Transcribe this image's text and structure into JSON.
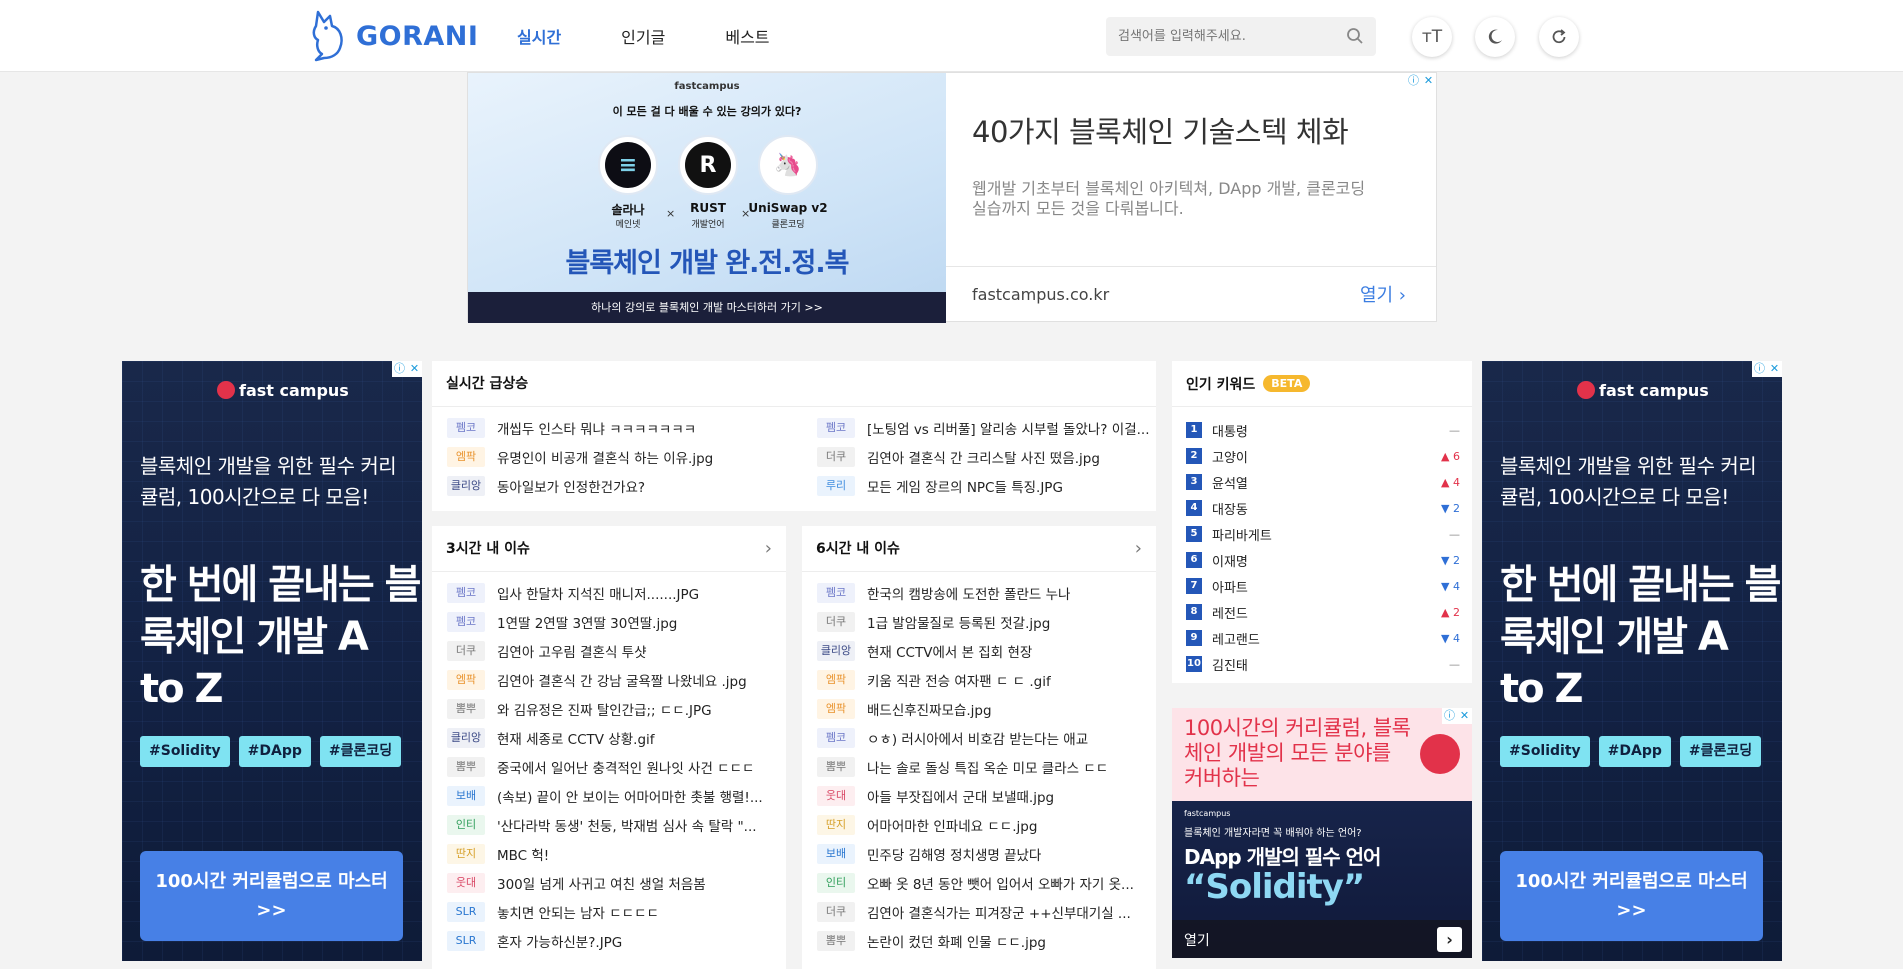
{
  "header": {
    "logo": "GORANI",
    "nav": [
      "실시간",
      "인기글",
      "베스트"
    ],
    "search_placeholder": "검색어를 입력해주세요.",
    "buttons": [
      "font-size-icon",
      "dark-mode-icon",
      "refresh-icon"
    ]
  },
  "top_ad": {
    "brand": "fastcampus",
    "question": "이 모든 걸 다 배울 수 있는 강의가 있다?",
    "coins": [
      {
        "name": "솔라나",
        "sub": "메인넷"
      },
      {
        "name": "RUST",
        "sub": "개발언어"
      },
      {
        "name": "UniSwap v2",
        "sub": "클론코딩"
      }
    ],
    "headline": "블록체인 개발 완.전.정.복",
    "bar": "하나의 강의로 블록체인 개발 마스터하러 가기 >>",
    "title": "40가지 블록체인 기술스텍 체화",
    "desc": "웹개발 기초부터 블록체인 아키텍쳐, DApp 개발, 클론코딩 실습까지 모든 것을 다뤄봅니다.",
    "url": "fastcampus.co.kr",
    "open": "열기"
  },
  "side_ad": {
    "brand": "fast campus",
    "line1": "블록체인 개발을 위한 필수 커리큘럼, 100시간으로 다 모음!",
    "line2": "한 번에 끝내는 블록체인 개발 A to Z",
    "tags": [
      "#Solidity",
      "#DApp",
      "#클론코딩"
    ],
    "cta": "100시간 커리큘럼으로 마스터 >>"
  },
  "realtime": {
    "title": "실시간 급상승",
    "left": [
      {
        "badge": "펨코",
        "title": "개씹두 인스타 뭐냐 ㅋㅋㅋㅋㅋㅋㅋ"
      },
      {
        "badge": "엠팍",
        "title": "유명인이 비공개 결혼식 하는 이유.jpg"
      },
      {
        "badge": "클리앙",
        "title": "동아일보가 인정한건가요?"
      }
    ],
    "right": [
      {
        "badge": "펨코",
        "title": "[노팅엄 vs 리버풀] 알리송 시부럴 돌았나? 이걸..."
      },
      {
        "badge": "더쿠",
        "title": "김연아 결혼식 간 크리스탈 사진 떴음.jpg"
      },
      {
        "badge": "루리",
        "title": "모든 게임 장르의 NPC들 특징.JPG"
      }
    ]
  },
  "three_hour": {
    "title": "3시간 내 이슈",
    "items": [
      {
        "badge": "펨코",
        "title": "입사 한달차 지석진 매니저.......JPG"
      },
      {
        "badge": "펨코",
        "title": "1연딸 2연딸 3연딸 30연딸.jpg"
      },
      {
        "badge": "더쿠",
        "title": "김연아 고우림 결혼식 투샷"
      },
      {
        "badge": "엠팍",
        "title": "김연아 결혼식 간 강남 굴욕짤 나왔네요 .jpg"
      },
      {
        "badge": "뽐뿌",
        "title": "와 김유정은 진짜 탈인간급;; ㄷㄷ.JPG"
      },
      {
        "badge": "클리앙",
        "title": "현재 세종로 CCTV 상황.gif"
      },
      {
        "badge": "뽐뿌",
        "title": "중국에서 일어난 충격적인 원나잇 사건 ㄷㄷㄷ"
      },
      {
        "badge": "보배",
        "title": "(속보) 끝이 안 보이는 어마어마한 촛불 행렬!..."
      },
      {
        "badge": "인티",
        "title": "'산다라박 동생' 천둥, 박재범 심사 속 탈락 \"..."
      },
      {
        "badge": "딴지",
        "title": "MBC 헉!"
      },
      {
        "badge": "웃대",
        "title": "300일 넘게 사귀고 여친 생얼 처음봄"
      },
      {
        "badge": "SLR",
        "title": "놓치면 안되는 남자 ㄷㄷㄷㄷ"
      },
      {
        "badge": "SLR",
        "title": "혼자 가능하신분?.JPG"
      }
    ]
  },
  "six_hour": {
    "title": "6시간 내 이슈",
    "items": [
      {
        "badge": "펨코",
        "title": "한국의 캠방송에 도전한 폴란드 누나"
      },
      {
        "badge": "더쿠",
        "title": "1급 발암물질로 등록된 젓갈.jpg"
      },
      {
        "badge": "클리앙",
        "title": "현재 CCTV에서 본 집회 현장"
      },
      {
        "badge": "엠팍",
        "title": "키움 직관 전승 여자팬 ㄷ ㄷ .gif"
      },
      {
        "badge": "엠팍",
        "title": "배드신후진짜모습.jpg"
      },
      {
        "badge": "펨코",
        "title": "ㅇㅎ) 러시아에서 비호감 받는다는 애교"
      },
      {
        "badge": "뽐뿌",
        "title": "나는 솔로 돌싱 특집 옥순 미모 클라스 ㄷㄷ"
      },
      {
        "badge": "웃대",
        "title": "아들 부잣집에서 군대 보낼때.jpg"
      },
      {
        "badge": "딴지",
        "title": "어마어마한 인파네요 ㄷㄷ.jpg"
      },
      {
        "badge": "보배",
        "title": "민주당 김해영 정치생명 끝났다"
      },
      {
        "badge": "인티",
        "title": "오빠 옷 8년 동안 뺏어 입어서 오빠가 자기 옷..."
      },
      {
        "badge": "더쿠",
        "title": "김연아 결혼식가는 피겨장군 ++신부대기실 ..."
      },
      {
        "badge": "뽐뿌",
        "title": "논란이 컸던 화폐 인물 ㄷㄷ.jpg"
      }
    ]
  },
  "keywords": {
    "title": "인기 키워드",
    "beta": "BETA",
    "items": [
      {
        "rank": "1",
        "word": "대통령",
        "trend": "—",
        "dir": "same"
      },
      {
        "rank": "2",
        "word": "고양이",
        "trend": "▲ 6",
        "dir": "up"
      },
      {
        "rank": "3",
        "word": "윤석열",
        "trend": "▲ 4",
        "dir": "up"
      },
      {
        "rank": "4",
        "word": "대장동",
        "trend": "▼ 2",
        "dir": "down"
      },
      {
        "rank": "5",
        "word": "파리바게트",
        "trend": "—",
        "dir": "same"
      },
      {
        "rank": "6",
        "word": "이재명",
        "trend": "▼ 2",
        "dir": "down"
      },
      {
        "rank": "7",
        "word": "아파트",
        "trend": "▼ 4",
        "dir": "down"
      },
      {
        "rank": "8",
        "word": "레전드",
        "trend": "▲ 2",
        "dir": "up"
      },
      {
        "rank": "9",
        "word": "레고랜드",
        "trend": "▼ 4",
        "dir": "down"
      },
      {
        "rank": "10",
        "word": "김진태",
        "trend": "—",
        "dir": "same"
      }
    ]
  },
  "small_ad": {
    "text": "100시간의 커리큘럼, 블록체인 개발의 모든 분야를 커버하는",
    "brand": "fastcampus",
    "l1": "블록체인 개발자라면 꼭 배워야 하는 언어?",
    "l2": "DApp 개발의 필수 언어",
    "l3": "“Solidity”",
    "open": "열기"
  }
}
